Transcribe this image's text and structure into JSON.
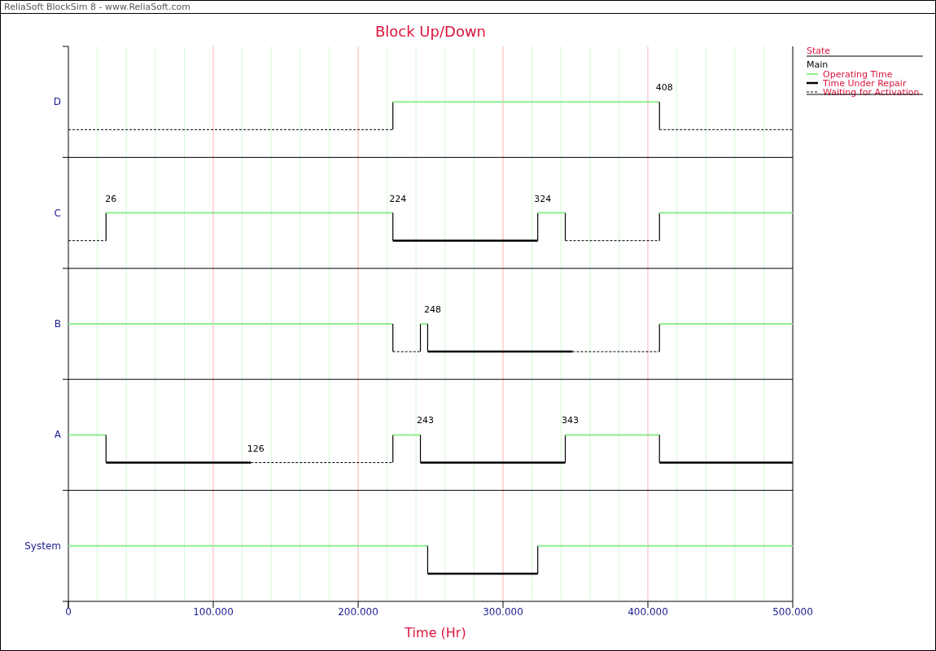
{
  "window": {
    "title": "ReliaSoft BlockSim 8 - www.ReliaSoft.com"
  },
  "chart": {
    "title": "Block Up/Down",
    "x_axis": {
      "title": "Time (Hr)",
      "tick_labels": [
        "0",
        "100.000",
        "200.000",
        "300.000",
        "400.000",
        "500.000"
      ]
    },
    "blocks": [
      {
        "name": "D",
        "event_labels": [
          "408"
        ]
      },
      {
        "name": "C",
        "event_labels": [
          "26",
          "224",
          "324"
        ]
      },
      {
        "name": "B",
        "event_labels": [
          "248"
        ]
      },
      {
        "name": "A",
        "event_labels": [
          "126",
          "243",
          "343"
        ]
      },
      {
        "name": "System"
      }
    ]
  },
  "legend": {
    "title": "State",
    "group": "Main",
    "items": [
      {
        "kind": "operating",
        "label": "Operating Time"
      },
      {
        "kind": "repair",
        "label": "Time Under Repair"
      },
      {
        "kind": "waiting",
        "label": "Waiting for Activation"
      }
    ]
  }
}
